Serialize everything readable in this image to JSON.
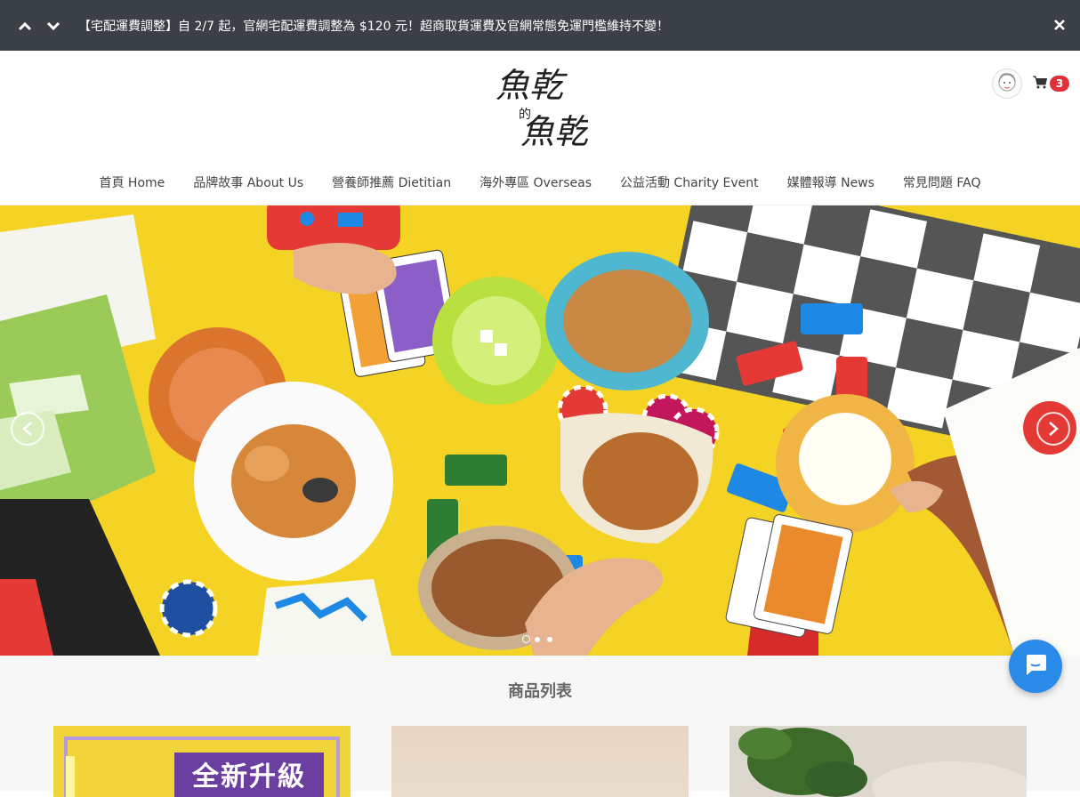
{
  "announcement": {
    "text": "【宅配運費調整】自 2/7 起，官網宅配運費調整為 $120 元！超商取貨運費及官網常態免運門檻維持不變！"
  },
  "brand": {
    "logo_text_top": "魚乾",
    "logo_text_mid": "的",
    "logo_text_bottom": "魚乾"
  },
  "cart": {
    "count": "3"
  },
  "nav": [
    {
      "label": "首頁 Home"
    },
    {
      "label": "品牌故事 About Us"
    },
    {
      "label": "營養師推薦 Dietitian"
    },
    {
      "label": "海外專區 Overseas"
    },
    {
      "label": "公益活動 Charity Event"
    },
    {
      "label": "媒體報導 News"
    },
    {
      "label": "常見問題 FAQ"
    }
  ],
  "hero": {
    "slide_count": 3,
    "active_slide": 1
  },
  "products": {
    "title": "商品列表",
    "cards": [
      {
        "tag": "全新升級"
      },
      {
        "tag": ""
      },
      {
        "tag": ""
      }
    ]
  },
  "colors": {
    "announce_bg": "#3b4046",
    "badge": "#e0313b",
    "hero_bg": "#f4d324",
    "chat": "#2a8ae8"
  }
}
